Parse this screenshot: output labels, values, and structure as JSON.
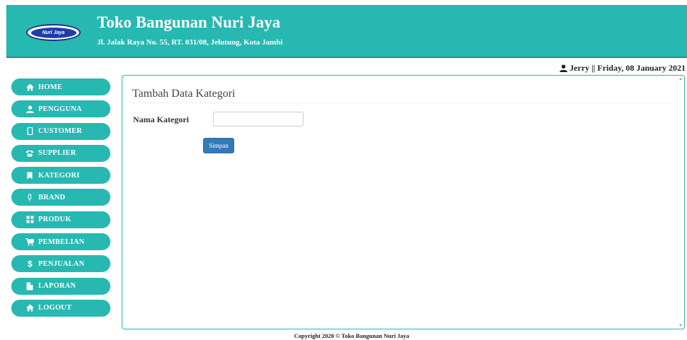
{
  "header": {
    "logo_text": "Nuri Jaya",
    "store_name": "Toko Bangunan Nuri Jaya",
    "address": "Jl. Jalak Raya No. 55, RT. 031/08, Jelutung, Kota Jambi",
    "bg_color": "#26b8b1"
  },
  "userbar": {
    "text": "Jerry || Friday, 08 January 2021",
    "icon": "user-icon"
  },
  "sidebar": {
    "items": [
      {
        "label": "HOME",
        "icon": "home-icon"
      },
      {
        "label": "PENGGUNA",
        "icon": "user-icon"
      },
      {
        "label": "CUSTOMER",
        "icon": "mobile-icon"
      },
      {
        "label": "SUPPLIER",
        "icon": "phone-icon"
      },
      {
        "label": "KATEGORI",
        "icon": "bookmark-icon"
      },
      {
        "label": "BRAND",
        "icon": "leaf-icon"
      },
      {
        "label": "PRODUK",
        "icon": "grid-icon"
      },
      {
        "label": "PEMBELIAN",
        "icon": "cart-icon"
      },
      {
        "label": "PENJUALAN",
        "icon": "dollar-icon"
      },
      {
        "label": "LAPORAN",
        "icon": "file-icon"
      },
      {
        "label": "LOGOUT",
        "icon": "home-icon"
      }
    ]
  },
  "form": {
    "title": "Tambah Data Kategori",
    "field_label": "Nama Kategori",
    "field_value": "",
    "save_label": "Simpan"
  },
  "footer": {
    "text": "Copyright 2020 © Toko Bangunan Nuri Jaya"
  }
}
